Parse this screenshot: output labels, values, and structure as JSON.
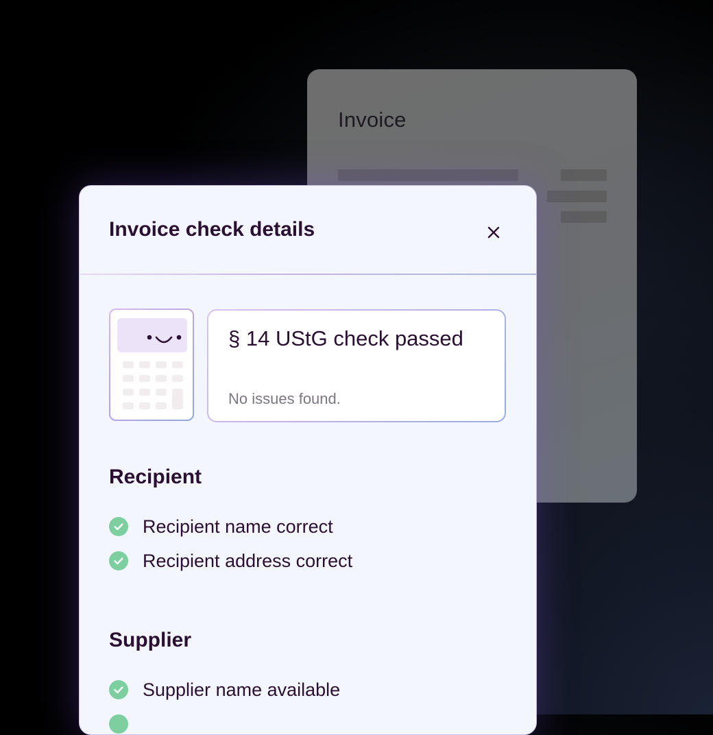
{
  "background_card": {
    "title": "Invoice"
  },
  "modal": {
    "title": "Invoice check details",
    "close_icon": "close-icon",
    "status": {
      "title": "§ 14 UStG check passed",
      "subtitle": "No issues found.",
      "icon": "calculator-smile-icon"
    },
    "sections": [
      {
        "heading": "Recipient",
        "items": [
          {
            "label": "Recipient name correct",
            "icon": "check-circle-icon"
          },
          {
            "label": "Recipient address correct",
            "icon": "check-circle-icon"
          }
        ]
      },
      {
        "heading": "Supplier",
        "items": [
          {
            "label": "Supplier name available",
            "icon": "check-circle-icon"
          }
        ]
      }
    ]
  },
  "colors": {
    "heading_text": "#2a0f33",
    "muted_text": "#7b7680",
    "check_green": "#7dcfa0",
    "panel_bg": "#f4f6fd",
    "calc_screen": "#ede3f8",
    "calc_keys": "#f1eced"
  }
}
